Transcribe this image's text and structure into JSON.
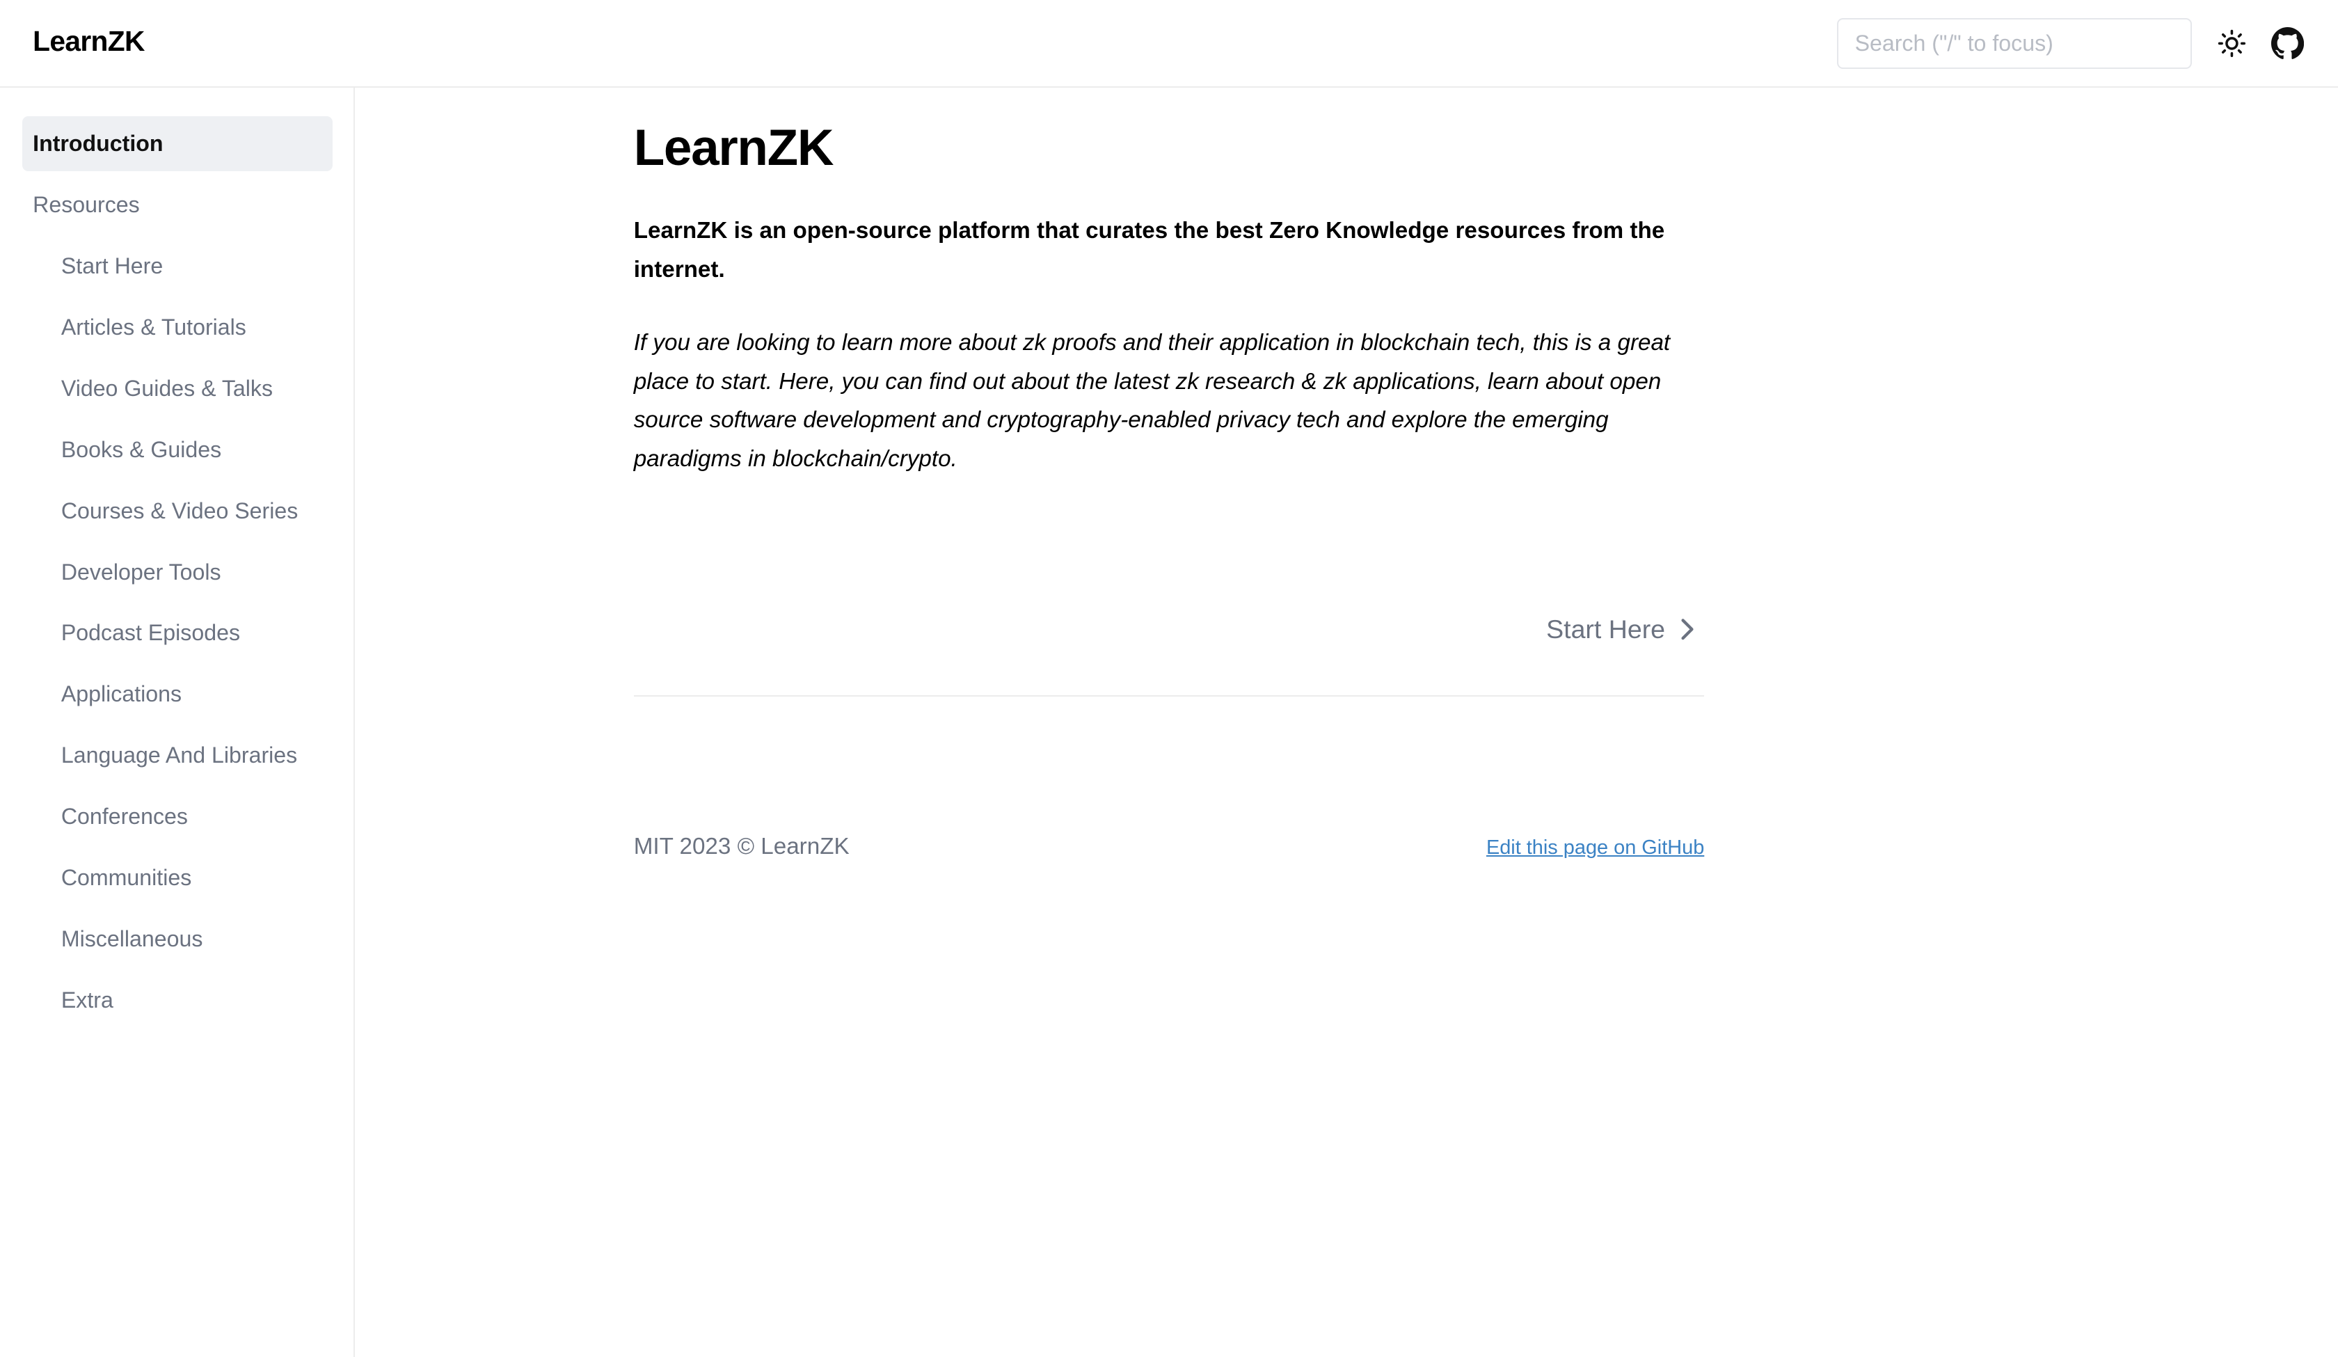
{
  "header": {
    "brand": "LearnZK",
    "search_placeholder": "Search (\"/\" to focus)",
    "theme_icon": "sun-icon",
    "github_icon": "github-icon"
  },
  "sidebar": {
    "active_item": "Introduction",
    "section": "Resources",
    "items": [
      "Start Here",
      "Articles & Tutorials",
      "Video Guides & Talks",
      "Books & Guides",
      "Courses & Video Series",
      "Developer Tools",
      "Podcast Episodes",
      "Applications",
      "Language And Libraries",
      "Conferences",
      "Communities",
      "Miscellaneous",
      "Extra"
    ]
  },
  "main": {
    "title": "LearnZK",
    "lead": "LearnZK is an open-source platform that curates the best Zero Knowledge resources from the internet.",
    "intro": "If you are looking to learn more about zk proofs and their application in blockchain tech, this is a great place to start. Here, you can find out about the latest zk research & zk applications, learn about open source software development and cryptography-enabled privacy tech and explore the emerging paradigms in blockchain/crypto.",
    "next_label": "Start Here",
    "next_icon": "chevron-right-icon"
  },
  "footer": {
    "copyright": "MIT 2023 © LearnZK",
    "edit_link": "Edit this page on GitHub"
  },
  "colors": {
    "muted_text": "#6b7280",
    "active_bg": "#eef0f3",
    "link": "#3b82c4",
    "border": "#ececec"
  }
}
